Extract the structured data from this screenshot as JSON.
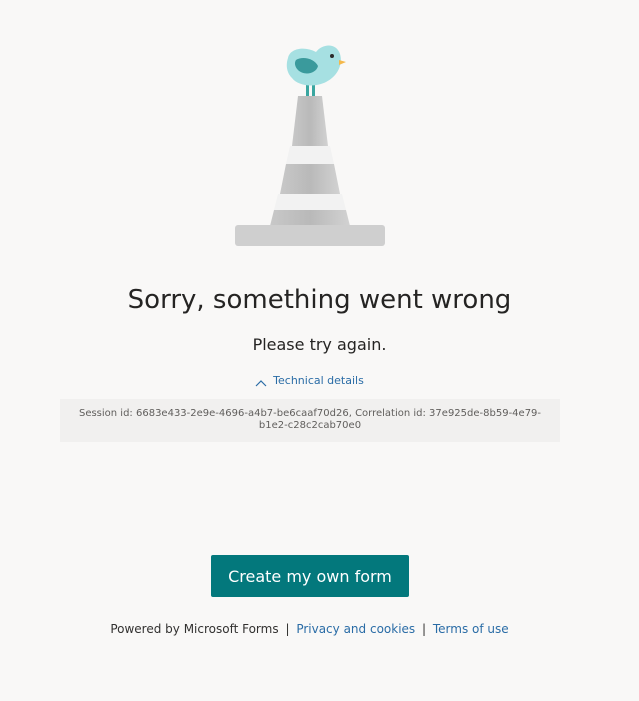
{
  "illustration": {
    "icon": "bird-on-traffic-cone-icon"
  },
  "error": {
    "title": "Sorry, something went wrong",
    "subtitle": "Please try again."
  },
  "technical_details": {
    "toggle_label": "Technical details",
    "toggle_icon": "chevron-up-icon",
    "text": "Session id: 6683e433-2e9e-4696-a4b7-be6caaf70d26, Correlation id: 37e925de-8b59-4e79-b1e2-c28c2cab70e0"
  },
  "cta": {
    "label": "Create my own form",
    "color": "#03787c"
  },
  "footer": {
    "powered_by": "Powered by Microsoft Forms",
    "separator": "|",
    "privacy_link": "Privacy and cookies",
    "terms_link": "Terms of use"
  },
  "colors": {
    "background": "#f9f8f7",
    "link": "#2a6ca6",
    "details_background": "#f1f0ef"
  }
}
